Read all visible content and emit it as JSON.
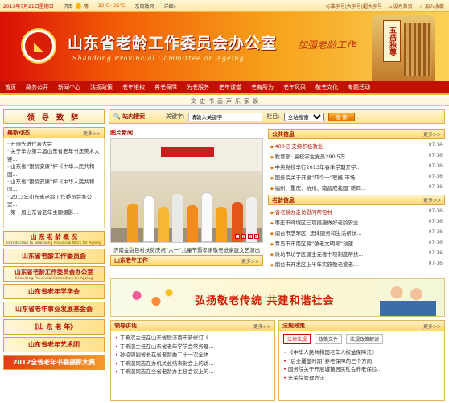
{
  "topbar": {
    "date": "2013年7月21日星期日",
    "city": "济南",
    "weather": "晴",
    "temp": "32℃~25℃",
    "wind": "东风微风",
    "detail": "详细»",
    "font_sizes": "标准字号|大字号|超大字号",
    "home": "设为首页",
    "favorite": "加入收藏"
  },
  "banner": {
    "title": "山东省老龄工作委员会办公室",
    "subtitle": "Shandong Provincial Committee on Ageing",
    "slogan": "加强老龄工作",
    "plaque": "五岳独尊"
  },
  "nav": [
    "首页",
    "政务公开",
    "新闻中心",
    "法规政策",
    "老年维权",
    "养老保障",
    "为老服务",
    "老年课堂",
    "老有所为",
    "老年风采",
    "敬老文化",
    "专题活动"
  ],
  "subnav": [
    "文",
    "史",
    "书",
    "画",
    "声",
    "乐",
    "家",
    "娱"
  ],
  "left": {
    "leader": "领 导 致 辞",
    "news_title": "最新动态",
    "more": "更多>>",
    "news": [
      "开颁先进代表大会",
      "关于举办第二届山东省老年书法美术大赛...",
      "山东省“银龄安康”杯《中华人民共和国...",
      "山东省“银龄安康”杯《中华人民共和国...",
      "2013年山东省老龄工作委员会办公室...",
      "第一届山东省老年主题摄影..."
    ],
    "banners": [
      {
        "cn": "山 东 老 龄 概 况",
        "en": "Introduction to Shandong Provincial Work for Ageing"
      },
      {
        "cn": "山东省老龄工作委员会",
        "en": ""
      },
      {
        "cn": "山东省老龄工作委员会办公室",
        "en": "Shandong Provincial Committee on Ageing"
      },
      {
        "cn": "山东省老年学学会",
        "en": ""
      },
      {
        "cn": "山东省老年事业发展基金会",
        "en": ""
      },
      {
        "cn": "《山 东 老 年》",
        "en": ""
      },
      {
        "cn": "山东省老年艺术团",
        "en": ""
      },
      {
        "cn": "2012全省老年书画摄影大赛",
        "en": ""
      }
    ]
  },
  "search": {
    "label": "站内搜索",
    "keyword_label": "关键字:",
    "keyword_value": "请输入关键字",
    "column_label": "栏目:",
    "column_value": "全站搜索",
    "button": "搜 索"
  },
  "picnews": {
    "title": "图片新闻",
    "caption": "济南金融包村扶贫庆祝“六一”儿童节暨孝亲敬老进家庭文艺演出",
    "bar_title": "山东老年工作",
    "more": "更多>>",
    "dots": [
      "1",
      "2",
      "3",
      "4"
    ]
  },
  "notices": {
    "title": "公共信息",
    "more": "更多>>",
    "items": [
      {
        "t": "400亿 支持积极救业",
        "d": "07-16"
      },
      {
        "t": "教育部: 高校学生党员290.5万",
        "d": "07-16"
      },
      {
        "t": "中央党校举行2013年春季学期开学...",
        "d": "07-16"
      },
      {
        "t": "国务院关于开展“四个一”联络 市场...",
        "d": "07-16"
      },
      {
        "t": "福州、重庆、杭州、南昌成我国“新四...",
        "d": "07-16"
      }
    ]
  },
  "aging": {
    "title": "老龄信息",
    "more": "更多>>",
    "items": [
      {
        "t": "省老龄办走访慰问帮包村",
        "d": "07-16"
      },
      {
        "t": "枣庄市峄城区三项措施做好老龄安全...",
        "d": "07-16"
      },
      {
        "t": "烟台市芝罘区: 法律服务和生活帮扶...",
        "d": "07-16"
      },
      {
        "t": "青岛市市南区将“敬老文明号”创建...",
        "d": "07-16"
      },
      {
        "t": "潍坊市坊子区健全完善十项制度帮扶...",
        "d": "07-16"
      },
      {
        "t": "烟台市开发区上半年实施敬老爱老...",
        "d": "07-16"
      }
    ]
  },
  "slogan_banner": "弘扬敬老传统  共建和谐社会",
  "speeches": {
    "title": "领导讲话",
    "more": "更多>>",
    "items": [
      "丁希滨主任在山东省暨济南市新修订《...",
      "丁希滨主任在山东省老年学学会常务理...",
      "孙绍骋副省长在省老龄委二十一次全体...",
      "丁希滨同志在办机关总结表彰会上的讲...",
      "丁希滨同志在全省老龄办主任会议上的..."
    ]
  },
  "laws": {
    "title": "法规政策",
    "more": "更多>>",
    "tabs": [
      "法律法规",
      "政策文件",
      "法规政策解读"
    ],
    "items": [
      "《中华人民共和国老年人权益保障法》",
      "“后全覆盖时期”养老保障的三个方向",
      "国务院关于开展城镇居民社会养老保险...",
      "光荣院管理办法"
    ]
  }
}
